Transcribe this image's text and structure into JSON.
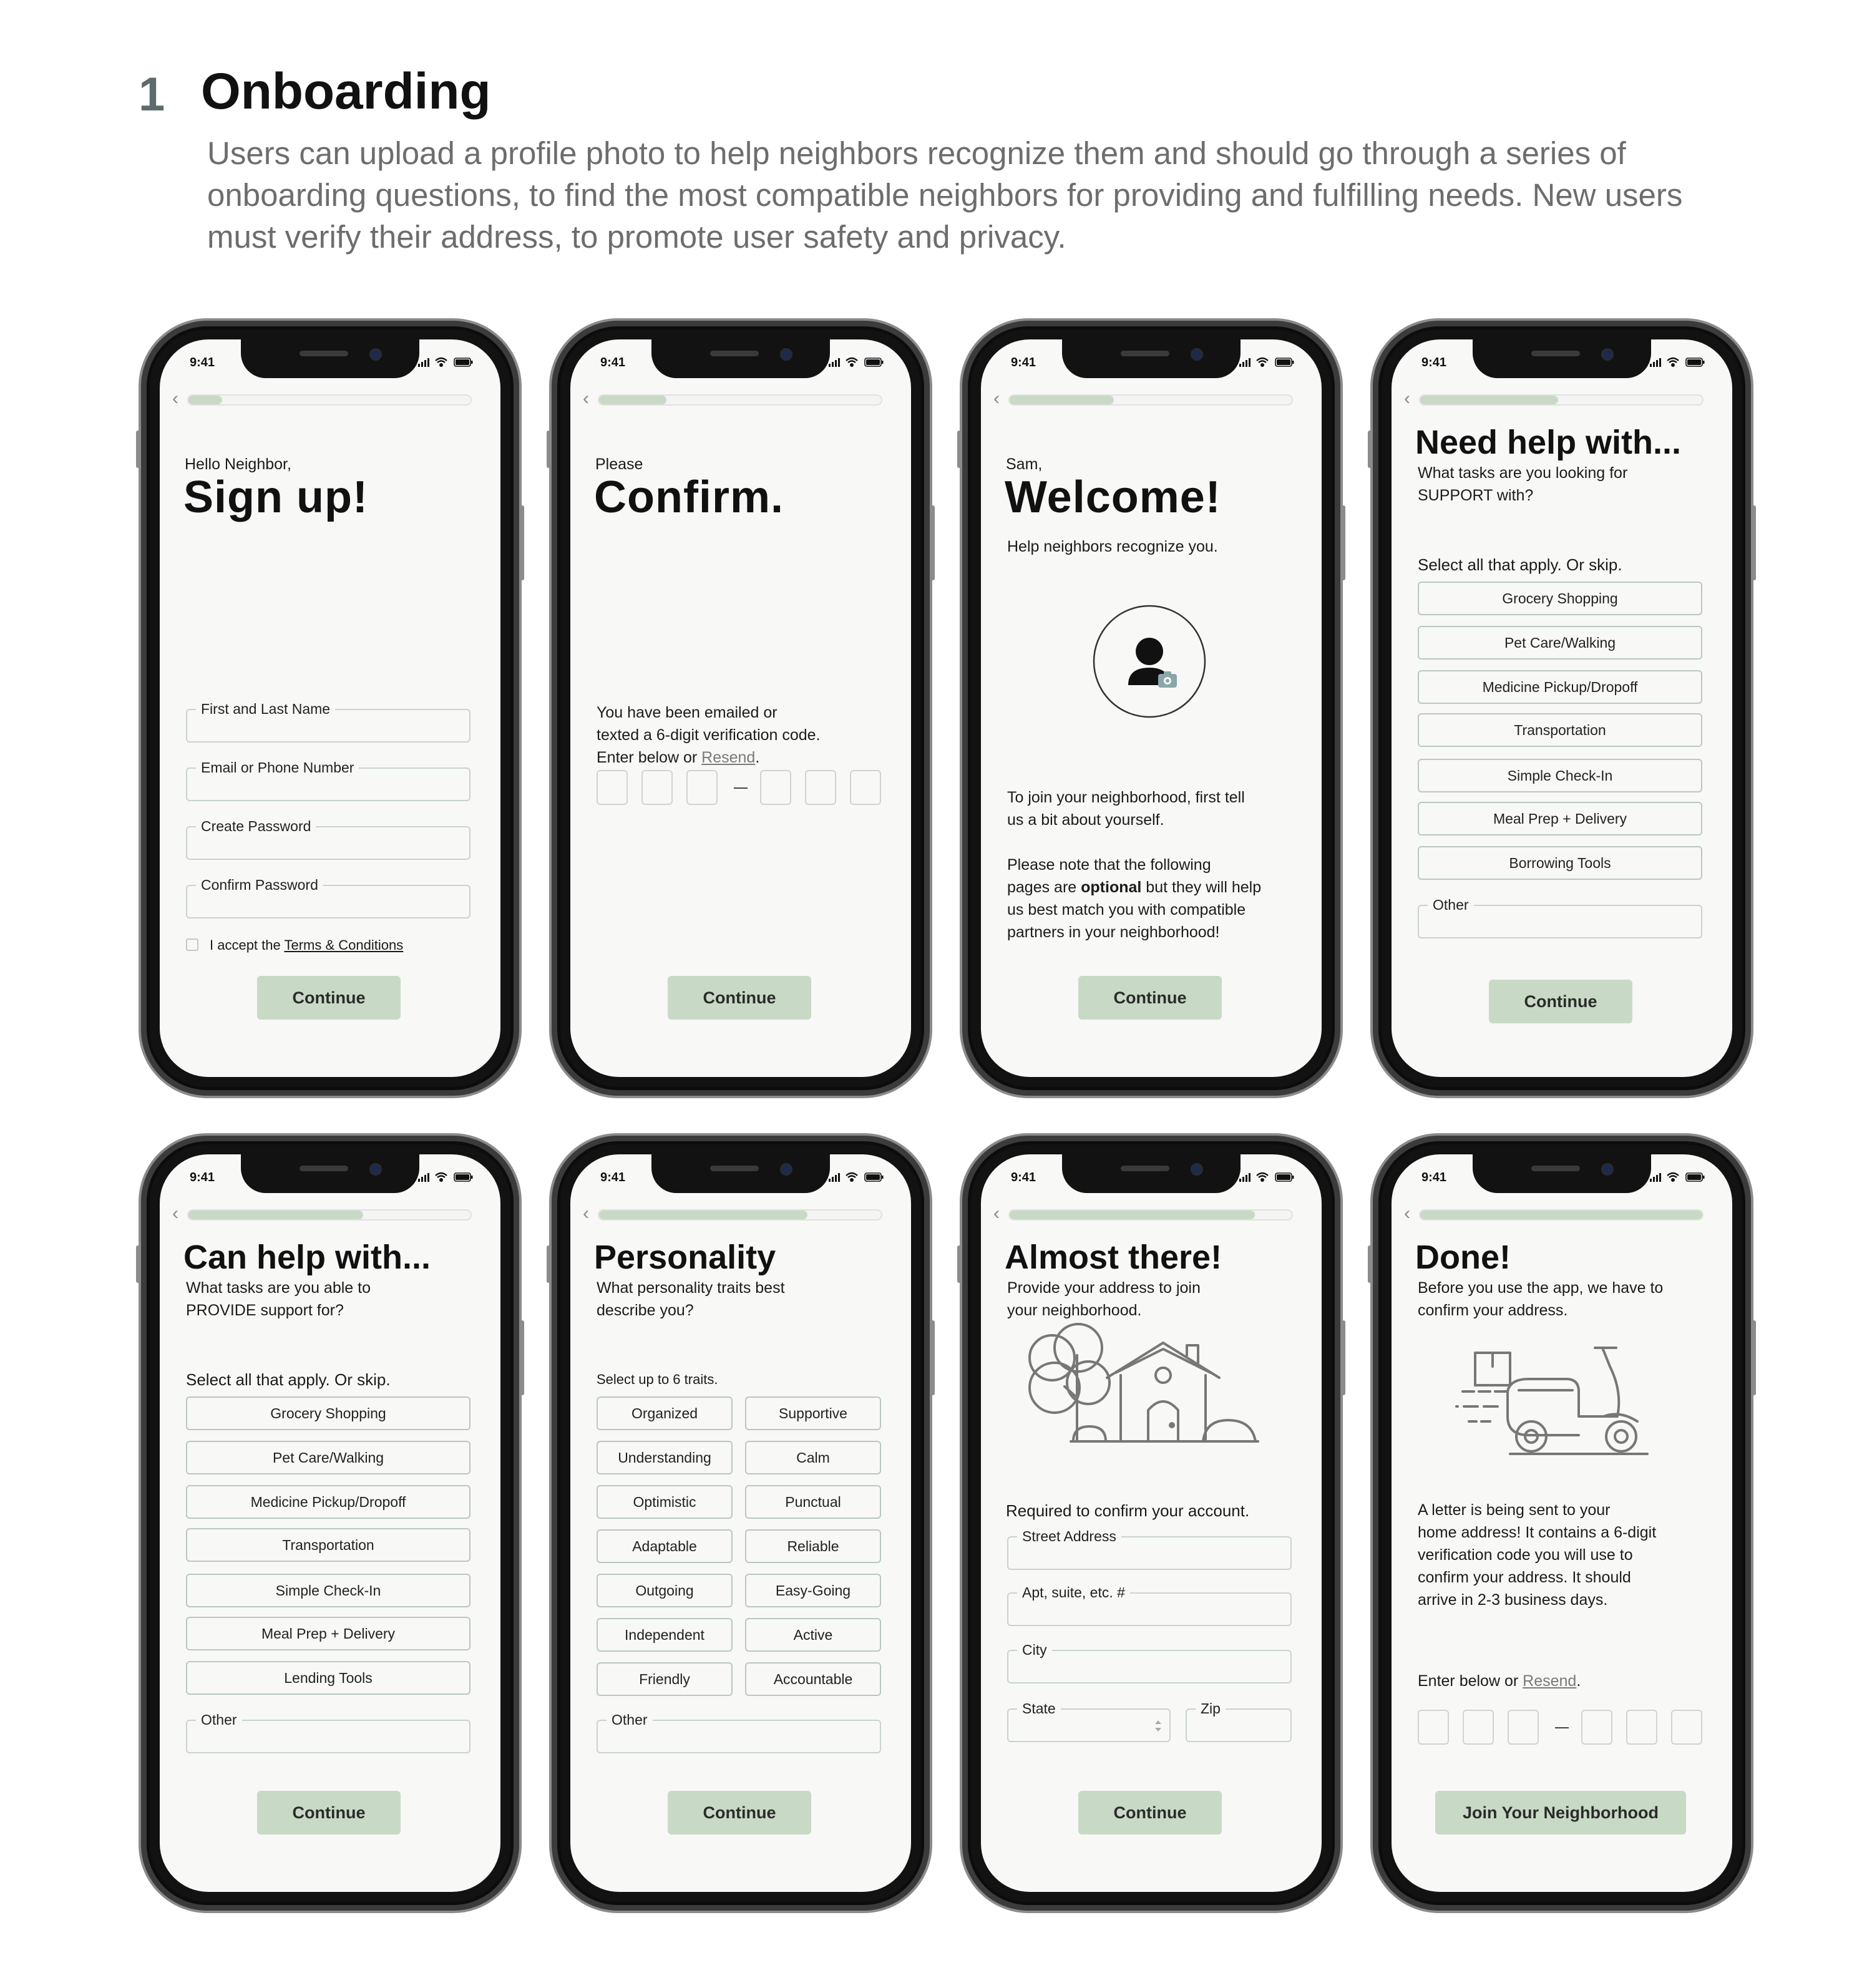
{
  "section": {
    "number": "1",
    "title": "Onboarding",
    "description": "Users can upload a profile photo to help neighbors recognize them and should go through a series of onboarding questions, to find the most compatible neighbors for providing and fulfilling needs. New users must verify their address, to promote user safety and privacy."
  },
  "common": {
    "time": "9:41",
    "continue": "Continue",
    "back_glyph": "‹",
    "code_dash": "–"
  },
  "screens": {
    "signup": {
      "progress": 0.12,
      "kicker": "Hello Neighbor,",
      "title": "Sign up!",
      "fields": [
        "First and Last Name",
        "Email or Phone Number",
        "Create Password",
        "Confirm Password"
      ],
      "terms_prefix": "I accept the ",
      "terms_link": "Terms & Conditions"
    },
    "confirm": {
      "progress": 0.24,
      "kicker": "Please",
      "title": "Confirm.",
      "line1": "You have been emailed or",
      "line2": "texted a 6-digit verification code.",
      "line3_prefix": "Enter below or ",
      "resend": "Resend",
      "period": "."
    },
    "welcome": {
      "progress": 0.37,
      "kicker": "Sam,",
      "title": "Welcome!",
      "subtitle": "Help neighbors recognize you.",
      "p1_l1": "To join your neighborhood, first tell",
      "p1_l2": "us a bit about yourself.",
      "p2_l1": "Please note that the following",
      "p2_l2_prefix": "pages are ",
      "p2_l2_bold": "optional",
      "p2_l2_suffix": " but they will help",
      "p2_l3": "us best match you with compatible",
      "p2_l4": "partners in your neighborhood!"
    },
    "need": {
      "progress": 0.49,
      "title": "Need help with...",
      "sub_l1": "What tasks are you looking for",
      "sub_l2": "SUPPORT with?",
      "select": "Select all that apply. Or skip.",
      "options": [
        "Grocery Shopping",
        "Pet Care/Walking",
        "Medicine Pickup/Dropoff",
        "Transportation",
        "Simple Check-In",
        "Meal Prep + Delivery",
        "Borrowing Tools"
      ],
      "other": "Other"
    },
    "can": {
      "progress": 0.62,
      "title": "Can help with...",
      "sub_l1": "What tasks are you able to",
      "sub_l2": "PROVIDE support for?",
      "select": "Select all that apply. Or skip.",
      "options": [
        "Grocery Shopping",
        "Pet Care/Walking",
        "Medicine Pickup/Dropoff",
        "Transportation",
        "Simple Check-In",
        "Meal Prep + Delivery",
        "Lending Tools"
      ],
      "other": "Other"
    },
    "personality": {
      "progress": 0.74,
      "title": "Personality",
      "sub_l1": "What personality traits best",
      "sub_l2": "describe you?",
      "select": "Select up to 6 traits.",
      "traits_left": [
        "Organized",
        "Understanding",
        "Optimistic",
        "Adaptable",
        "Outgoing",
        "Independent",
        "Friendly"
      ],
      "traits_right": [
        "Supportive",
        "Calm",
        "Punctual",
        "Reliable",
        "Easy-Going",
        "Active",
        "Accountable"
      ],
      "other": "Other"
    },
    "almost": {
      "progress": 0.87,
      "title": "Almost there!",
      "sub_l1": "Provide your address to join",
      "sub_l2": "your neighborhood.",
      "required": "Required to confirm your account.",
      "street": "Street Address",
      "apt": "Apt, suite, etc. #",
      "city": "City",
      "state": "State",
      "zip": "Zip"
    },
    "done": {
      "progress": 1.0,
      "title": "Done!",
      "sub_l1": "Before you use the app, we have to",
      "sub_l2": "confirm your address.",
      "p_l1": "A letter is being sent to your",
      "p_l2": "home address! It contains a 6-digit",
      "p_l3": "verification code you will use to",
      "p_l4": "confirm your address. It should",
      "p_l5": "arrive in 2-3 business days.",
      "enter_prefix": "Enter below or ",
      "resend": "Resend",
      "period": ".",
      "button": "Join Your Neighborhood"
    }
  },
  "colors": {
    "accent": "#c8dac5",
    "border": "#b9c7c4",
    "screen_bg": "#f8f8f7",
    "frame": "#121212"
  },
  "icons": [
    "back-chevron-icon",
    "signal-icon",
    "wifi-icon",
    "battery-icon",
    "avatar-upload-icon",
    "camera-icon",
    "house-illustration",
    "scooter-delivery-illustration",
    "select-arrows-icon"
  ]
}
